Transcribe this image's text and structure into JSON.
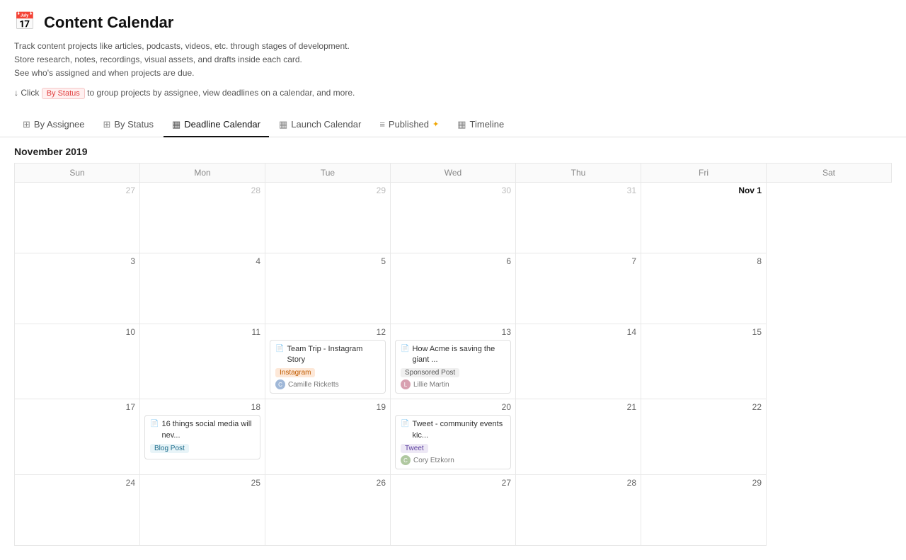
{
  "header": {
    "icon": "📅",
    "title": "Content Calendar",
    "description_lines": [
      "Track content projects like articles, podcasts, videos, etc. through stages of development.",
      "Store research, notes, recordings, visual assets, and drafts inside each card.",
      "See who's assigned and when projects are due."
    ],
    "hint_prefix": "↓ Click",
    "hint_badge": "By Status",
    "hint_suffix": "to group projects by assignee, view deadlines on a calendar, and more."
  },
  "tabs": [
    {
      "id": "by-assignee",
      "icon": "▦",
      "label": "By Assignee",
      "active": false
    },
    {
      "id": "by-status",
      "icon": "▦",
      "label": "By Status",
      "active": false
    },
    {
      "id": "deadline-calendar",
      "icon": "▦",
      "label": "Deadline Calendar",
      "active": true
    },
    {
      "id": "launch-calendar",
      "icon": "▦",
      "label": "Launch Calendar",
      "active": false
    },
    {
      "id": "published",
      "icon": "≡",
      "label": "Published",
      "active": false,
      "star": true
    },
    {
      "id": "timeline",
      "icon": "▦",
      "label": "Timeline",
      "active": false
    }
  ],
  "calendar": {
    "month_title": "November 2019",
    "day_headers": [
      "Sun",
      "Mon",
      "Tue",
      "Wed",
      "Thu",
      "Fri",
      "Sat"
    ],
    "weeks": [
      [
        {
          "num": "27",
          "other": true,
          "cards": []
        },
        {
          "num": "28",
          "other": true,
          "cards": []
        },
        {
          "num": "29",
          "other": true,
          "cards": []
        },
        {
          "num": "30",
          "other": true,
          "cards": []
        },
        {
          "num": "31",
          "other": true,
          "cards": []
        },
        {
          "num": "Nov 1",
          "bold": true,
          "cards": []
        },
        {
          "num": "",
          "other": true,
          "cards": [],
          "hidden": true
        }
      ],
      [
        {
          "num": "3",
          "cards": []
        },
        {
          "num": "4",
          "cards": []
        },
        {
          "num": "5",
          "cards": []
        },
        {
          "num": "6",
          "cards": []
        },
        {
          "num": "7",
          "cards": []
        },
        {
          "num": "8",
          "cards": []
        },
        {
          "num": "",
          "hidden": true,
          "cards": []
        }
      ],
      [
        {
          "num": "10",
          "cards": []
        },
        {
          "num": "11",
          "cards": []
        },
        {
          "num": "12",
          "cards": [
            {
              "title": "Team Trip - Instagram Story",
              "tag": "Instagram",
              "tag_class": "tag-instagram",
              "assignee": "Camille Ricketts",
              "avatar_class": "avatar-camille"
            }
          ]
        },
        {
          "num": "13",
          "cards": [
            {
              "title": "How Acme is saving the giant ...",
              "tag": "Sponsored Post",
              "tag_class": "tag-sponsored",
              "assignee": "Lillie Martin",
              "avatar_class": "avatar-lillie"
            }
          ]
        },
        {
          "num": "14",
          "cards": []
        },
        {
          "num": "15",
          "cards": []
        },
        {
          "num": "",
          "hidden": true,
          "cards": []
        }
      ],
      [
        {
          "num": "17",
          "cards": []
        },
        {
          "num": "18",
          "cards": [
            {
              "title": "16 things social media will nev...",
              "tag": "Blog Post",
              "tag_class": "tag-blog",
              "assignee": null,
              "avatar_class": null
            }
          ]
        },
        {
          "num": "19",
          "cards": []
        },
        {
          "num": "20",
          "cards": [
            {
              "title": "Tweet - community events kic...",
              "tag": "Tweet",
              "tag_class": "tag-tweet",
              "assignee": "Cory Etzkorn",
              "avatar_class": "avatar-cory"
            }
          ]
        },
        {
          "num": "21",
          "cards": []
        },
        {
          "num": "22",
          "cards": []
        },
        {
          "num": "",
          "hidden": true,
          "cards": []
        }
      ],
      [
        {
          "num": "24",
          "cards": []
        },
        {
          "num": "25",
          "cards": []
        },
        {
          "num": "26",
          "cards": []
        },
        {
          "num": "27",
          "cards": []
        },
        {
          "num": "28",
          "cards": []
        },
        {
          "num": "29",
          "cards": []
        },
        {
          "num": "",
          "hidden": true,
          "cards": []
        }
      ]
    ]
  }
}
